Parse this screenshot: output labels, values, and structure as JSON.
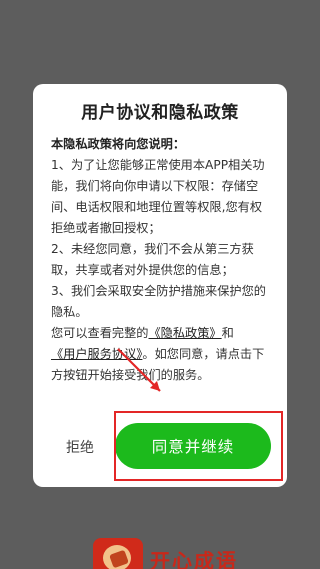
{
  "dialog": {
    "title": "用户协议和隐私政策",
    "intro": "本隐私政策将向您说明：",
    "items": [
      "1、为了让您能够正常使用本APP相关功能，我们将向你申请以下权限：存储空间、电话权限和地理位置等权限,您有权拒绝或者撤回授权；",
      "2、未经您同意，我们不会从第三方获取，共享或者对外提供您的信息；",
      "3、我们会采取安全防护措施来保护您的隐私。"
    ],
    "policy_prefix": "您可以查看完整的",
    "privacy_link": "《隐私政策》",
    "and_text": "和",
    "service_link": "《用户服务协议》",
    "policy_suffix": "。如您同意，请点击下方按钮开始接受我们的服务。",
    "reject_label": "拒绝",
    "agree_label": "同意并继续"
  },
  "annotation": {
    "color": "#e32626"
  },
  "background_app": {
    "name": "开心成语"
  },
  "colors": {
    "overlay": "#5d5d5d",
    "accent_green": "#1cba1c",
    "highlight_red": "#e32626"
  }
}
